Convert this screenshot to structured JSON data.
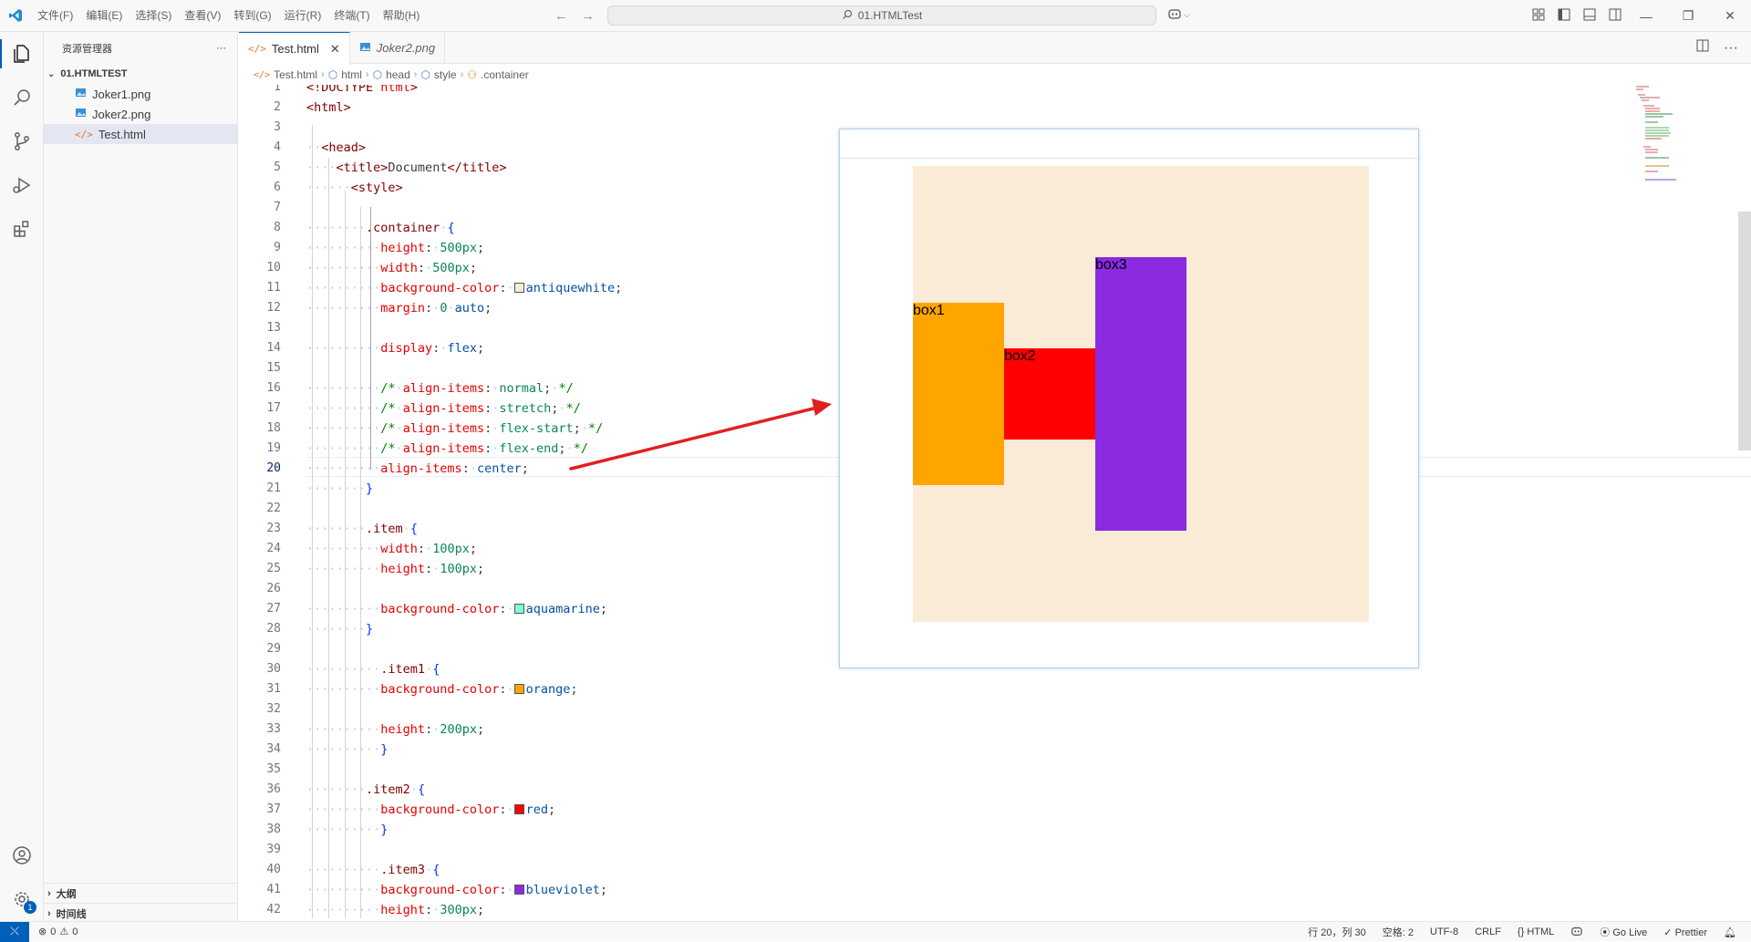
{
  "titlebar": {
    "menu": [
      "文件(F)",
      "编辑(E)",
      "选择(S)",
      "查看(V)",
      "转到(G)",
      "运行(R)",
      "终端(T)",
      "帮助(H)"
    ],
    "search_text": "01.HTMLTest"
  },
  "sidebar": {
    "title": "资源管理器",
    "folder": "01.HTMLTEST",
    "files": [
      {
        "name": "Joker1.png",
        "icon": "image-file-icon"
      },
      {
        "name": "Joker2.png",
        "icon": "image-file-icon"
      },
      {
        "name": "Test.html",
        "icon": "html-file-icon",
        "selected": true
      }
    ],
    "outline_label": "大纲",
    "timeline_label": "时间线",
    "settings_badge": "1"
  },
  "tabs": [
    {
      "label": "Test.html",
      "active": true
    },
    {
      "label": "Joker2.png",
      "active": false
    }
  ],
  "breadcrumb": [
    "Test.html",
    "html",
    "head",
    "style",
    ".container"
  ],
  "editor": {
    "current_line": 20,
    "line_numbers": [
      "1",
      "2",
      "3",
      "4",
      "5",
      "6",
      "7",
      "8",
      "9",
      "10",
      "11",
      "12",
      "13",
      "14",
      "15",
      "16",
      "17",
      "18",
      "19",
      "20",
      "21",
      "22",
      "23",
      "24",
      "25",
      "26",
      "27",
      "28",
      "29",
      "30",
      "31",
      "32",
      "33",
      "34",
      "35",
      "36",
      "37",
      "38",
      "39",
      "40",
      "41",
      "42"
    ]
  },
  "preview": {
    "items": [
      "box1",
      "box2",
      "box3"
    ],
    "colors": {
      "container": "#faebd7",
      "box1": "#ffa500",
      "box2": "#ff0000",
      "box3": "#8a2be2"
    }
  },
  "statusbar": {
    "errors": "0",
    "warnings": "0",
    "position": "行 20，列 30",
    "spaces": "空格: 2",
    "encoding": "UTF-8",
    "eol": "CRLF",
    "language": "HTML",
    "golive": "Go Live",
    "prettier": "Prettier"
  },
  "accent_color": "#005fb8"
}
